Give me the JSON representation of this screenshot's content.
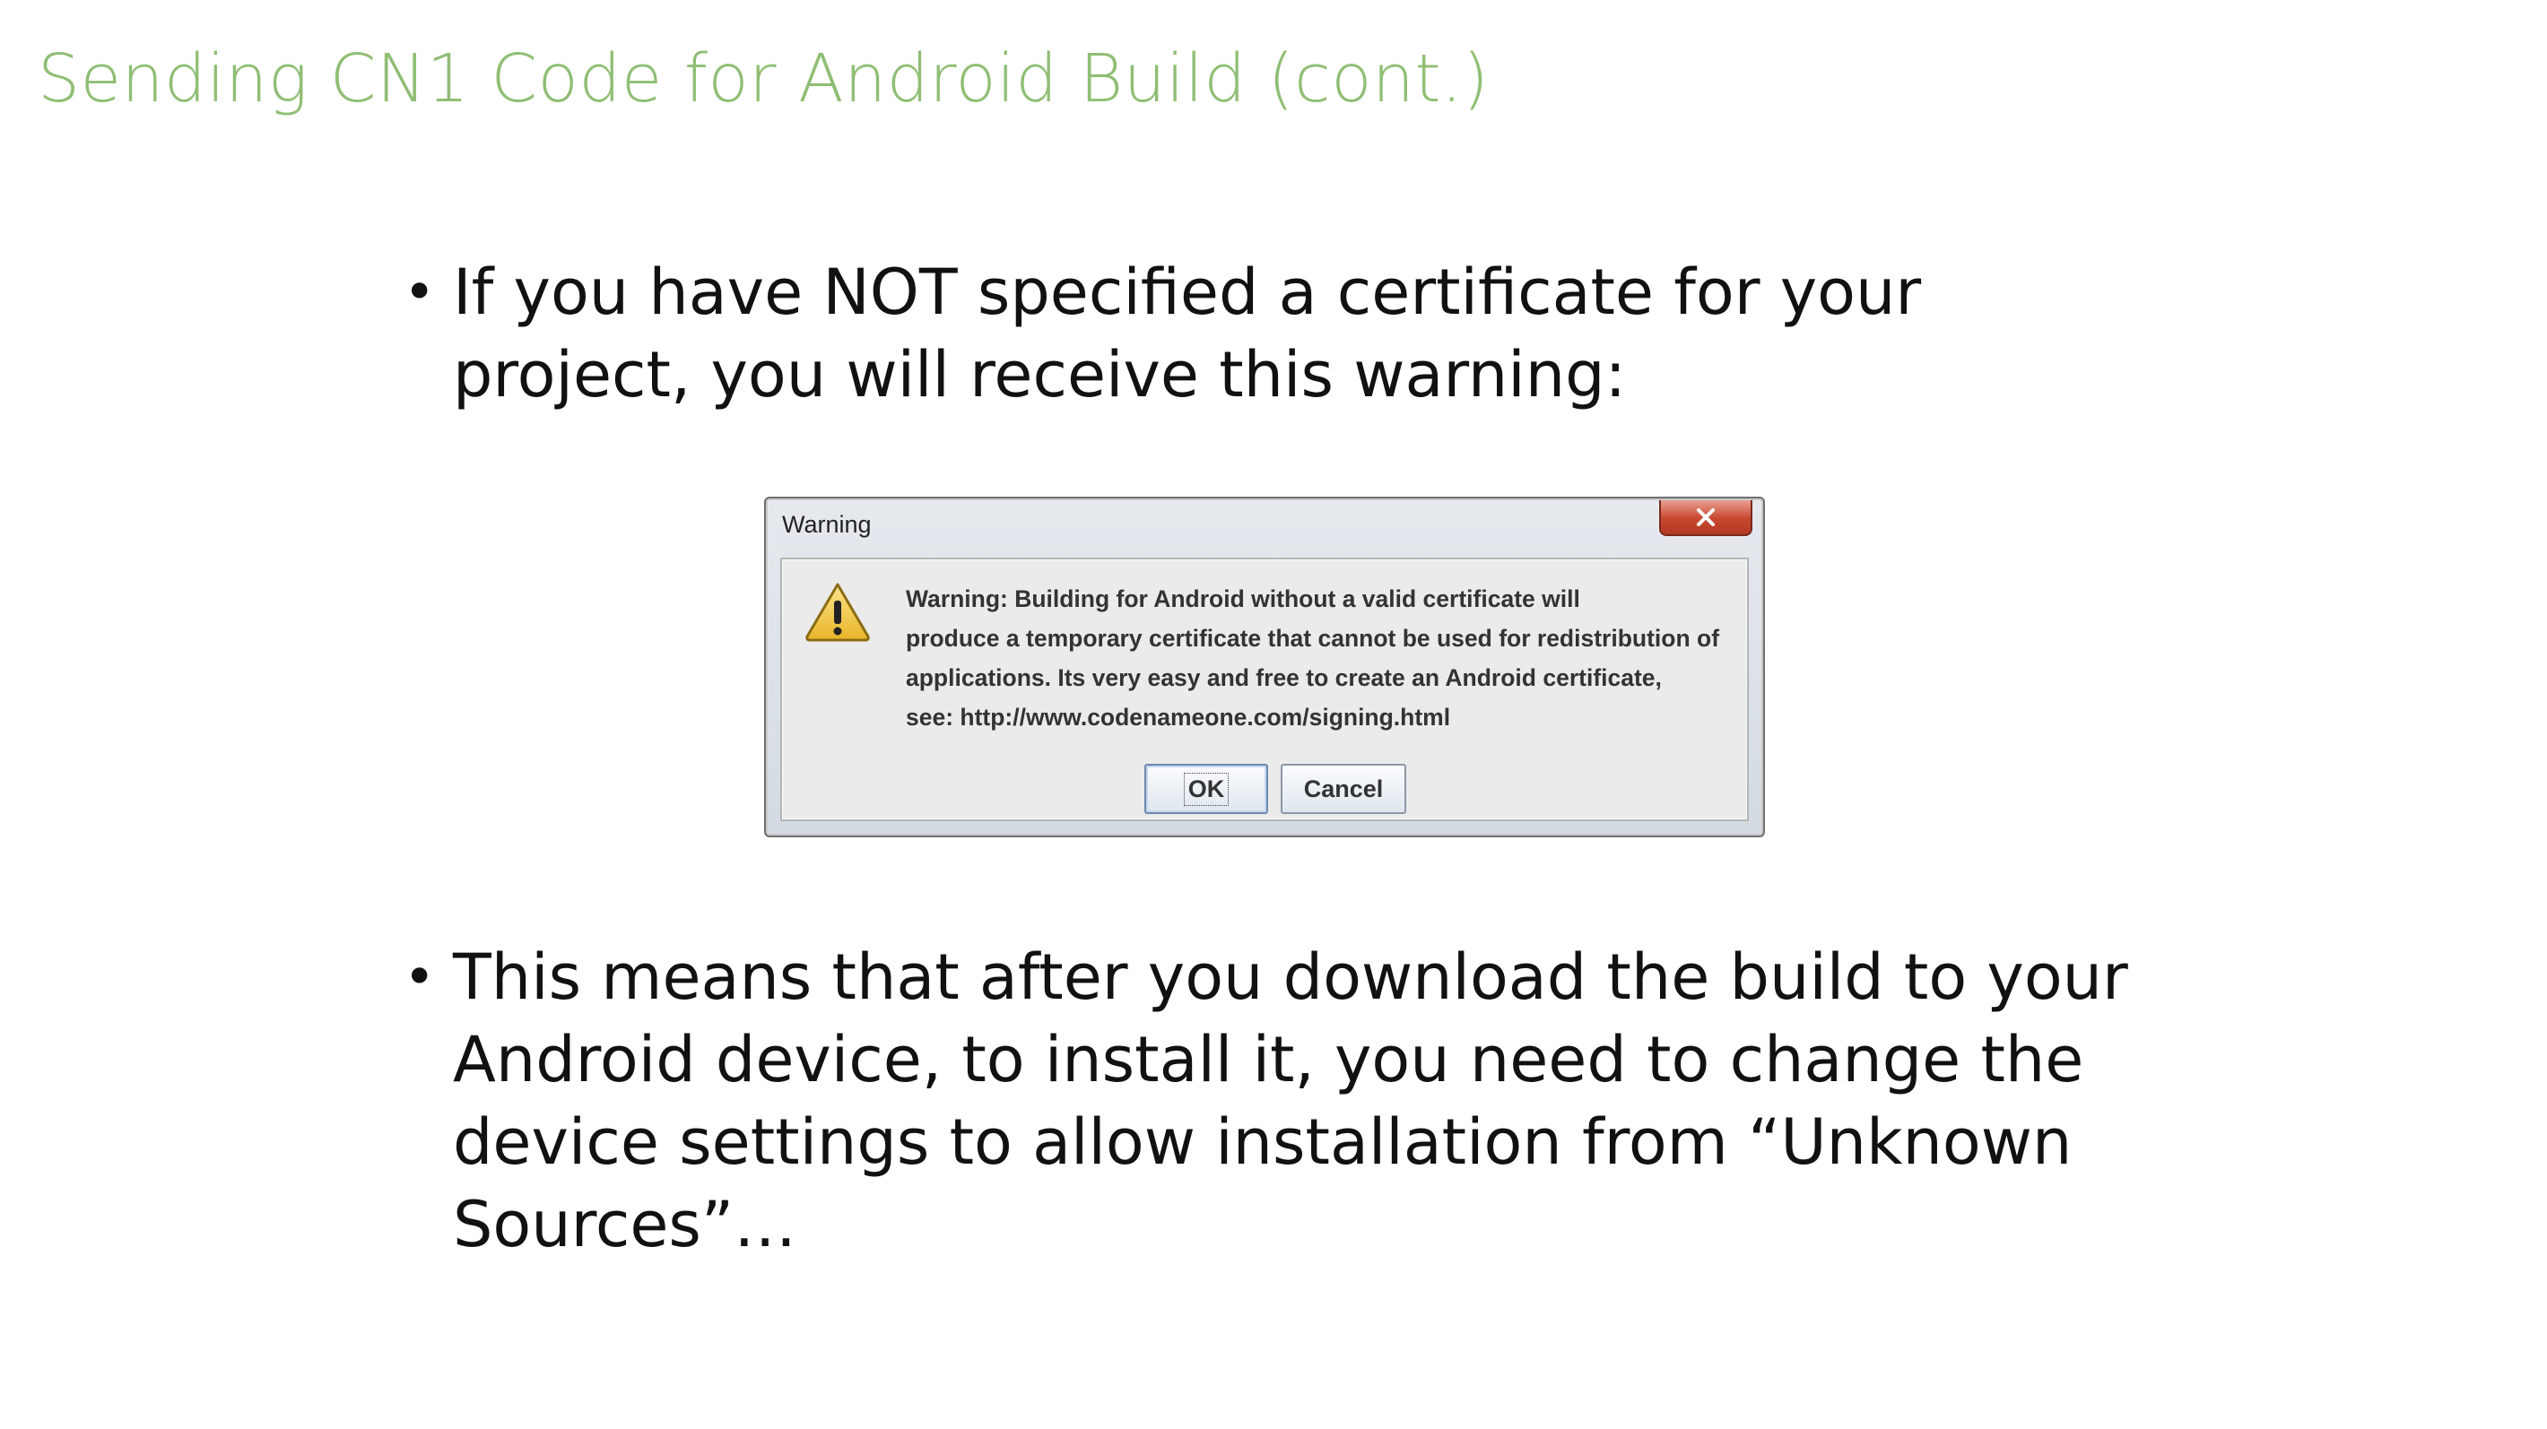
{
  "slide": {
    "title": "Sending CN1 Code for Android Build (cont.)",
    "bullet1": {
      "lines": [
        "If you have NOT specified a certificate for your",
        "project, you will receive this warning:"
      ]
    },
    "bullet2": {
      "lines": [
        "This means that after you download the build to your",
        "Android device, to install it, you need to change the",
        "device settings to allow installation from “Unknown",
        "Sources”…"
      ]
    },
    "bullet_glyph": "•"
  },
  "dialog": {
    "title": "Warning",
    "icon": "warning-triangle-icon",
    "close_icon": "close-icon",
    "message_lines": [
      "Warning: Building for Android without a valid certificate will",
      "produce a temporary certificate that cannot be used for redistribution of",
      "applications. Its very easy and free to create an Android certificate,",
      "see: http://www.codenameone.com/signing.html"
    ],
    "ok_label": "OK",
    "cancel_label": "Cancel"
  },
  "colors": {
    "title": "#8fbe74",
    "body_text": "#111111",
    "close_button": "#c8462f",
    "warning_icon": "#f1c232"
  }
}
